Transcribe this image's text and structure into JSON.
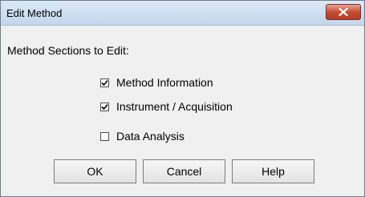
{
  "window": {
    "title": "Edit Method",
    "close_icon": "close-icon"
  },
  "section_label": "Method Sections to Edit:",
  "checkboxes": [
    {
      "label": "Method Information",
      "checked": true
    },
    {
      "label": "Instrument / Acquisition",
      "checked": true
    },
    {
      "label": "Data Analysis",
      "checked": false
    }
  ],
  "buttons": {
    "ok": "OK",
    "cancel": "Cancel",
    "help": "Help"
  },
  "colors": {
    "close_button": "#c74d35",
    "titlebar": "#c4d6ec",
    "dialog_bg": "#f0f0f0"
  }
}
